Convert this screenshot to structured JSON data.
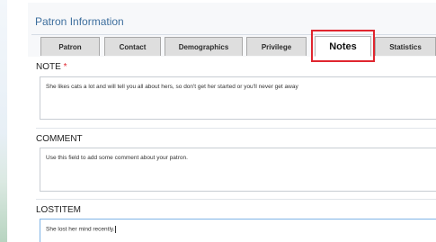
{
  "panel": {
    "title": "Patron Information"
  },
  "tabs": [
    {
      "label": "Patron"
    },
    {
      "label": "Contact"
    },
    {
      "label": "Demographics"
    },
    {
      "label": "Privilege"
    },
    {
      "label": "Notes",
      "active": true
    },
    {
      "label": "Statistics"
    }
  ],
  "sections": {
    "note": {
      "label": "NOTE",
      "required_marker": "*",
      "value": "She likes cats a lot and will tell you all about hers, so don't get her started or you'll never get away"
    },
    "comment": {
      "label": "COMMENT",
      "value": "Use this field to add some comment about your patron."
    },
    "lostitem": {
      "label": "LOSTITEM",
      "value": "She lost her mind recently."
    }
  },
  "colors": {
    "accent": "#3e6f9e",
    "highlight": "#e0262f",
    "required": "#e0262f"
  }
}
